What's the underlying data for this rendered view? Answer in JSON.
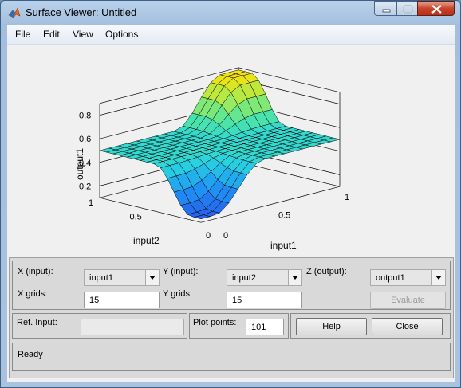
{
  "window": {
    "title": "Surface Viewer: Untitled"
  },
  "menu": [
    "File",
    "Edit",
    "View",
    "Options"
  ],
  "plot": {
    "zlabel": "output1",
    "xlabel": "input1",
    "ylabel": "input2",
    "z_ticks": [
      "0.2",
      "0.4",
      "0.6",
      "0.8"
    ],
    "x_ticks": [
      "0",
      "0.5",
      "1"
    ],
    "y_ticks": [
      "0",
      "0.5",
      "1"
    ]
  },
  "controls": {
    "x_input_label": "X (input):",
    "x_input_value": "input1",
    "y_input_label": "Y (input):",
    "y_input_value": "input2",
    "z_output_label": "Z (output):",
    "z_output_value": "output1",
    "x_grids_label": "X grids:",
    "x_grids_value": "15",
    "y_grids_label": "Y grids:",
    "y_grids_value": "15",
    "evaluate_label": "Evaluate",
    "ref_input_label": "Ref. Input:",
    "ref_input_value": "",
    "plot_points_label": "Plot points:",
    "plot_points_value": "101",
    "help_label": "Help",
    "close_label": "Close"
  },
  "status": "Ready"
}
